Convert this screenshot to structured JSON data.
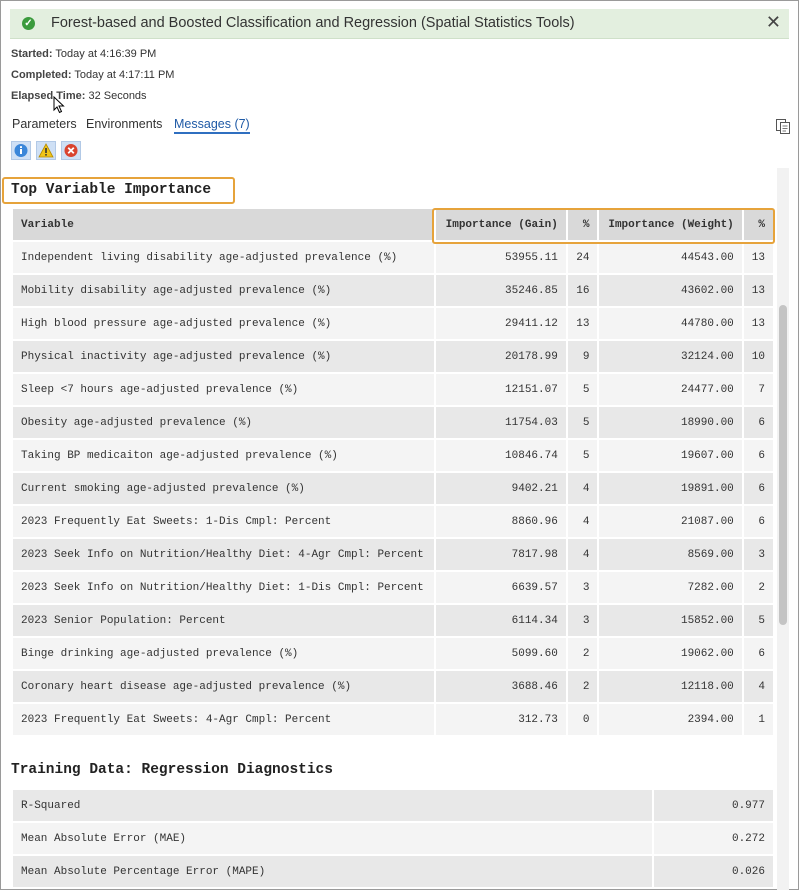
{
  "banner": {
    "title": "Forest-based and Boosted Classification and Regression (Spatial Statistics Tools)",
    "status_icon": "check-circle-icon",
    "close_glyph": "✕"
  },
  "run_info": {
    "started_label": "Started:",
    "started_value": "Today at 4:16:39 PM",
    "completed_label": "Completed:",
    "completed_value": "Today at 4:17:11 PM",
    "elapsed_label": "Elapsed Time:",
    "elapsed_value": "32 Seconds"
  },
  "tabs": [
    {
      "label": "Parameters",
      "active": false
    },
    {
      "label": "Environments",
      "active": false
    },
    {
      "label": "Messages (7)",
      "active": true
    }
  ],
  "filters": [
    "info-filter-icon",
    "warning-filter-icon",
    "error-filter-icon"
  ],
  "importance": {
    "heading": "Top Variable Importance",
    "columns": [
      "Variable",
      "Importance (Gain)",
      "%",
      "Importance (Weight)",
      "%"
    ],
    "rows": [
      [
        "Independent living disability age-adjusted prevalence (%)",
        "53955.11",
        "24",
        "44543.00",
        "13"
      ],
      [
        "Mobility disability age-adjusted prevalence (%)",
        "35246.85",
        "16",
        "43602.00",
        "13"
      ],
      [
        "High blood pressure age-adjusted prevalence (%)",
        "29411.12",
        "13",
        "44780.00",
        "13"
      ],
      [
        "Physical inactivity age-adjusted prevalence (%)",
        "20178.99",
        "9",
        "32124.00",
        "10"
      ],
      [
        "Sleep <7 hours age-adjusted prevalence (%)",
        "12151.07",
        "5",
        "24477.00",
        "7"
      ],
      [
        "Obesity age-adjusted prevalence (%)",
        "11754.03",
        "5",
        "18990.00",
        "6"
      ],
      [
        "Taking BP medicaiton age-adjusted prevalence (%)",
        "10846.74",
        "5",
        "19607.00",
        "6"
      ],
      [
        "Current smoking age-adjusted prevalence (%)",
        "9402.21",
        "4",
        "19891.00",
        "6"
      ],
      [
        "2023 Frequently Eat Sweets: 1-Dis Cmpl: Percent",
        "8860.96",
        "4",
        "21087.00",
        "6"
      ],
      [
        "2023 Seek Info on Nutrition/Healthy Diet: 4-Agr Cmpl: Percent",
        "7817.98",
        "4",
        "8569.00",
        "3"
      ],
      [
        "2023 Seek Info on Nutrition/Healthy Diet: 1-Dis Cmpl: Percent",
        "6639.57",
        "3",
        "7282.00",
        "2"
      ],
      [
        "2023 Senior Population: Percent",
        "6114.34",
        "3",
        "15852.00",
        "5"
      ],
      [
        "Binge drinking age-adjusted prevalence (%)",
        "5099.60",
        "2",
        "19062.00",
        "6"
      ],
      [
        "Coronary heart disease age-adjusted prevalence (%)",
        "3688.46",
        "2",
        "12118.00",
        "4"
      ],
      [
        "2023 Frequently Eat Sweets: 4-Agr Cmpl: Percent",
        "312.73",
        "0",
        "2394.00",
        "1"
      ]
    ]
  },
  "diagnostics": {
    "heading": "Training Data: Regression Diagnostics",
    "rows": [
      [
        "R-Squared",
        "0.977"
      ],
      [
        "Mean Absolute Error (MAE)",
        "0.272"
      ],
      [
        "Mean Absolute Percentage Error (MAPE)",
        "0.026"
      ]
    ]
  },
  "colors": {
    "banner_bg": "#e3efdf",
    "success": "#3b9b3d",
    "highlight": "#e6a33b",
    "active_tab": "#1f5aa6"
  }
}
